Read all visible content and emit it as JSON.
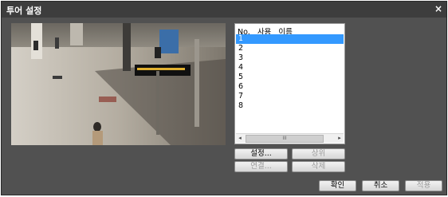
{
  "dialog": {
    "title": "투어 설정",
    "close_glyph": "×"
  },
  "camera_list": {
    "headers": [
      "No.",
      "사용",
      "이름"
    ],
    "rows": [
      "1",
      "2",
      "3",
      "4",
      "5",
      "6",
      "7",
      "8"
    ],
    "selected_index": 0,
    "scroll_left": "◂",
    "scroll_right": "▸",
    "scroll_thumb": "III"
  },
  "buttons": {
    "settings": "설정...",
    "up": "상위",
    "connect": "연결...",
    "delete": "삭제",
    "ok": "확인",
    "cancel": "취소",
    "apply": "적용"
  },
  "colors": {
    "dialog_bg": "#515151",
    "titlebar_bg": "#3d3d3d",
    "selection": "#3399ff"
  }
}
